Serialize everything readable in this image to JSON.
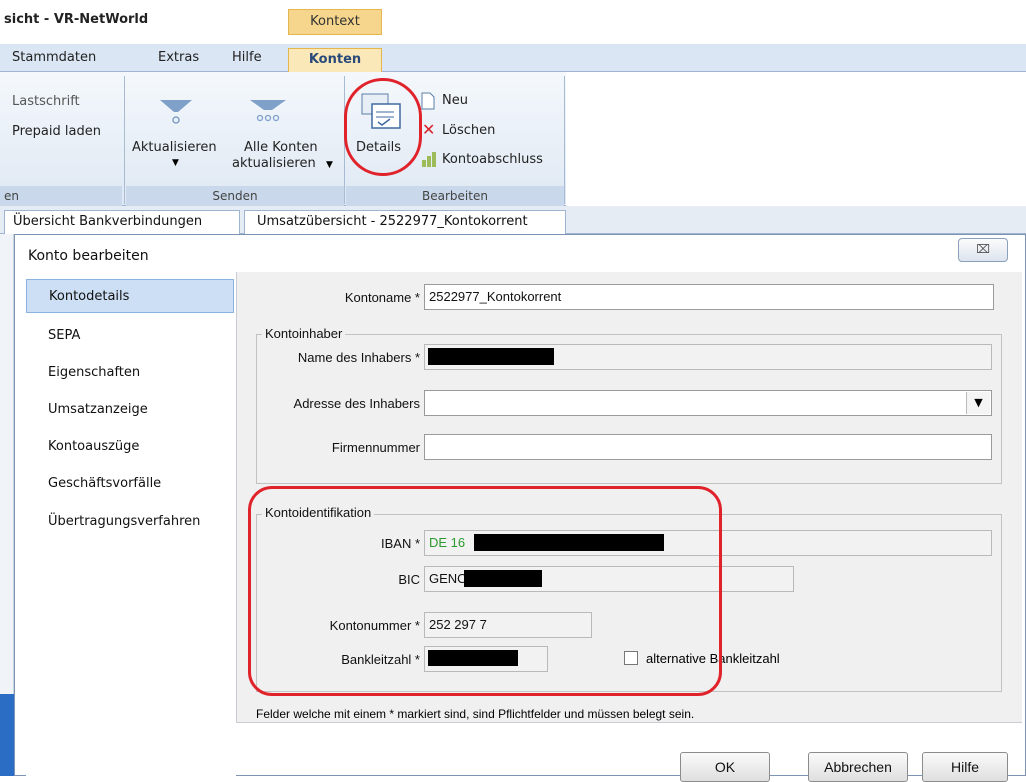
{
  "app": {
    "title": "sicht - VR-NetWorld",
    "context_label": "Kontext"
  },
  "menu": {
    "tabs": [
      "Stammdaten",
      "Extras",
      "Hilfe",
      "Konten"
    ]
  },
  "ribbon": {
    "left_items": [
      "Lastschrift",
      "Prepaid laden"
    ],
    "left_group_label": "en",
    "aktualisieren": "Aktualisieren",
    "alle_konten_1": "Alle Konten",
    "alle_konten_2": "aktualisieren",
    "senden_group": "Senden",
    "details": "Details",
    "neu": "Neu",
    "loeschen": "Löschen",
    "kontoabschluss": "Kontoabschluss",
    "bearbeiten_group": "Bearbeiten"
  },
  "doc_tabs": [
    "Übersicht Bankverbindungen",
    "Umsatzübersicht - 2522977_Kontokorrent"
  ],
  "dialog": {
    "title": "Konto bearbeiten",
    "close": "⌧",
    "nav": [
      "Kontodetails",
      "SEPA",
      "Eigenschaften",
      "Umsatzanzeige",
      "Kontoauszüge",
      "Geschäftsvorfälle",
      "Übertragungsverfahren"
    ],
    "kontoname_label": "Kontoname *",
    "kontoname_value": "2522977_Kontokorrent",
    "kontoinhaber_title": "Kontoinhaber",
    "name_label": "Name des Inhabers *",
    "adresse_label": "Adresse des Inhabers",
    "firmennummer_label": "Firmennummer",
    "kontoident_title": "Kontoidentifikation",
    "iban_label": "IBAN *",
    "iban_value": "DE 16",
    "bic_label": "BIC",
    "bic_value": "GENO",
    "kontonummer_label": "Kontonummer *",
    "kontonummer_value": "252 297 7",
    "blz_label": "Bankleitzahl *",
    "alt_blz_label": "alternative Bankleitzahl",
    "footnote": "Felder welche mit einem * markiert sind, sind Pflichtfelder und müssen belegt sein.",
    "ok": "OK",
    "abbrechen": "Abbrechen",
    "hilfe": "Hilfe"
  },
  "colors": {
    "highlight": "#e0232b",
    "iban_text": "#2c9a2c",
    "selected_nav": "#ccdff5"
  }
}
